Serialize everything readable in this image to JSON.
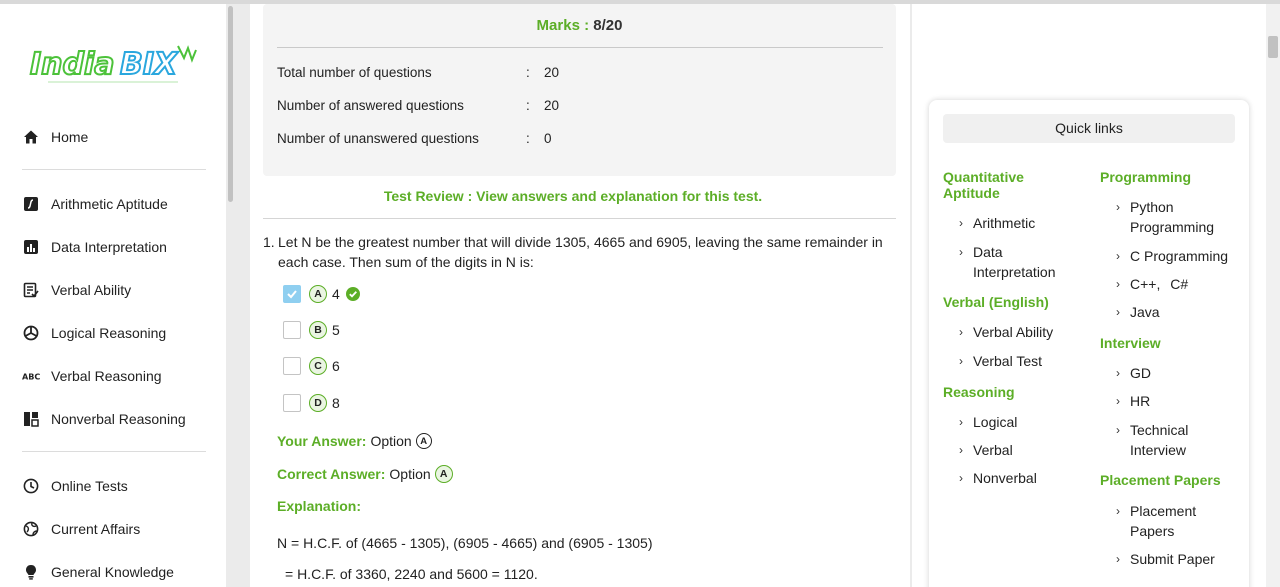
{
  "sidebar": {
    "logo_text": "IndiaBIX",
    "primary": [
      {
        "label": "Home",
        "icon": "home-icon"
      }
    ],
    "topics": [
      {
        "label": "Arithmetic Aptitude",
        "icon": "arithmetic-icon"
      },
      {
        "label": "Data Interpretation",
        "icon": "bar-chart-icon"
      },
      {
        "label": "Verbal Ability",
        "icon": "verbal-ability-icon"
      },
      {
        "label": "Logical Reasoning",
        "icon": "logic-icon"
      },
      {
        "label": "Verbal Reasoning",
        "icon": "abc-icon"
      },
      {
        "label": "Nonverbal Reasoning",
        "icon": "nonverbal-icon"
      }
    ],
    "more": [
      {
        "label": "Online Tests",
        "icon": "clock-icon"
      },
      {
        "label": "Current Affairs",
        "icon": "globe-icon"
      },
      {
        "label": "General Knowledge",
        "icon": "bulb-icon"
      }
    ]
  },
  "summary": {
    "marks_label": "Marks :",
    "marks_value": "8/20",
    "rows": [
      {
        "label": "Total number of questions",
        "sep": ":",
        "value": "20"
      },
      {
        "label": "Number of answered questions",
        "sep": ":",
        "value": "20"
      },
      {
        "label": "Number of unanswered questions",
        "sep": ":",
        "value": "0"
      }
    ]
  },
  "review_text": "Test Review : View answers and explanation for this test.",
  "question": {
    "number": "1.",
    "text": "Let N be the greatest number that will divide 1305, 4665 and 6905, leaving the same remainder in each case. Then sum of the digits in N is:",
    "options": [
      {
        "letter": "A",
        "value": "4",
        "checked": true,
        "correct": true
      },
      {
        "letter": "B",
        "value": "5",
        "checked": false,
        "correct": false
      },
      {
        "letter": "C",
        "value": "6",
        "checked": false,
        "correct": false
      },
      {
        "letter": "D",
        "value": "8",
        "checked": false,
        "correct": false
      }
    ],
    "your_answer_label": "Your Answer:",
    "your_answer_text": "Option",
    "your_answer_letter": "A",
    "correct_answer_label": "Correct Answer:",
    "correct_answer_text": "Option",
    "correct_answer_letter": "A",
    "explanation_label": "Explanation:",
    "explanation_lines": [
      "N = H.C.F. of (4665 - 1305), (6905 - 4665) and (6905 - 1305)",
      "= H.C.F. of 3360, 2240 and 5600 = 1120."
    ]
  },
  "quick_links": {
    "title": "Quick links",
    "col1": [
      {
        "category": "Quantitative Aptitude",
        "links": [
          "Arithmetic",
          "Data Interpretation"
        ]
      },
      {
        "category": "Verbal (English)",
        "links": [
          "Verbal Ability",
          "Verbal Test"
        ]
      },
      {
        "category": "Reasoning",
        "links": [
          "Logical",
          "Verbal",
          "Nonverbal"
        ]
      }
    ],
    "col2": [
      {
        "category": "Programming",
        "links": [
          "Python Programming",
          "C Programming",
          "C++, C#",
          "Java"
        ]
      },
      {
        "category": "Interview",
        "links": [
          "GD",
          "HR",
          "Technical Interview"
        ]
      },
      {
        "category": "Placement Papers",
        "links": [
          "Placement Papers",
          "Submit Paper"
        ]
      }
    ]
  },
  "colors": {
    "accent_green": "#5cae27",
    "checkbox_checked": "#8fcff0"
  }
}
